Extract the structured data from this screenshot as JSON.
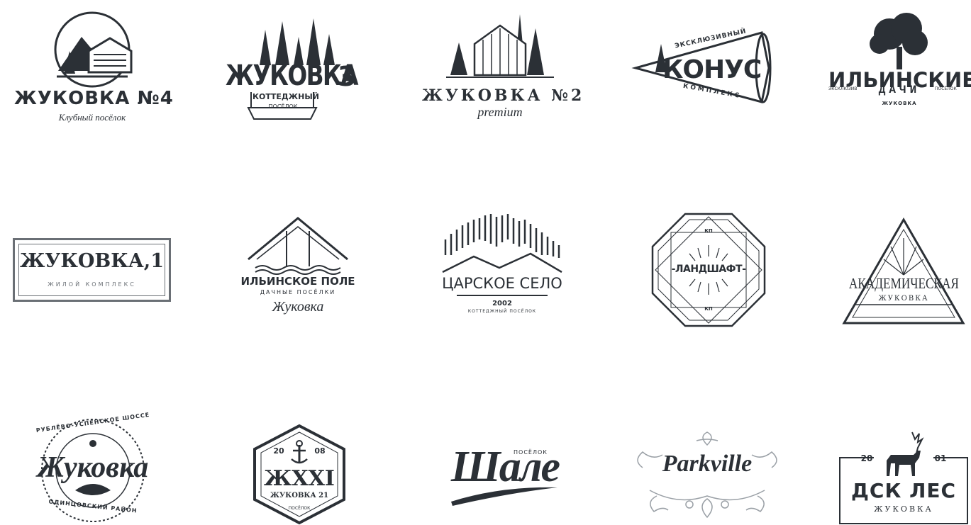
{
  "colors": {
    "ink": "#2b3036",
    "light_ink": "#6a6f75",
    "background": "#ffffff"
  },
  "logos": [
    {
      "name": "zhukovka-4",
      "title": "ЖУКОВКА №4",
      "subtitle": "Клубный посёлок",
      "icon": "mountain-house-icon"
    },
    {
      "name": "zhukovka-3",
      "title": "ЖУКОВКА",
      "number": "3",
      "subtitle": "КОТТЕДЖНЫЙ",
      "small": "ПОСЁЛОК",
      "icon": "pine-forest-icon"
    },
    {
      "name": "zhukovka-2",
      "title": "ЖУКОВКА №2",
      "script": "premium",
      "icon": "house-trees-icon"
    },
    {
      "name": "konus",
      "title": "КОНУС",
      "top": "ЭКСКЛЮЗИВНЫЙ",
      "bottom": "КОМПЛЕКС",
      "icon": "megaphone-icon"
    },
    {
      "name": "ilinskie-dachi",
      "title": "ИЛЬИНСКИЕ",
      "subtitle": "ДАЧИ",
      "small": "ЖУКОВКА",
      "left": "ЭКСКЛЮЗИВ",
      "right": "ПОСЁЛОК",
      "icon": "tree-icon"
    },
    {
      "name": "zhukovka-1",
      "title": "ЖУКОВКА,1",
      "subtitle": "ЖИЛОЙ КОМПЛЕКС"
    },
    {
      "name": "ilinskoe-pole",
      "title": "ИЛЬИНСКОЕ ПОЛЕ",
      "subtitle": "ДАЧНЫЕ ПОСЁЛКИ",
      "script": "Жуковка",
      "icon": "roof-house-icon"
    },
    {
      "name": "tsarskoe-selo",
      "title": "ЦАРСКОЕ СЕЛО",
      "year": "2002",
      "bottom": "КОТТЕДЖНЫЙ ПОСЁЛОК",
      "icon": "aurora-mountain-icon"
    },
    {
      "name": "landshaft",
      "title": "-ЛАНДШАФТ-",
      "top": "КП",
      "bottom": "КП",
      "icon": "octagon-badge-icon"
    },
    {
      "name": "akademicheskaya",
      "title": "АКАДЕМИЧЕСКАЯ",
      "subtitle": "ЖУКОВКА",
      "icon": "triangle-icon"
    },
    {
      "name": "zhukovka-script",
      "title": "Жуковка",
      "top": "РУБЛЁВО-УСПЕНСКОЕ ШОССЕ",
      "bottom": "ОДИНЦОВСКИЙ РАЙОН",
      "icon": "round-stamp-icon"
    },
    {
      "name": "zhxxi",
      "title": "ЖXXI",
      "subtitle": "ЖУКОВКА 21",
      "left_year": "20",
      "right_year": "08",
      "small": "ПОСЁЛОК",
      "icon": "anchor-icon"
    },
    {
      "name": "shale",
      "title": "Шале",
      "small": "ПОСЁЛОК"
    },
    {
      "name": "parkville",
      "title": "Parkville",
      "icon": "floral-ornament-icon"
    },
    {
      "name": "dsk-les",
      "title": "ДСК ЛЕС",
      "subtitle": "ЖУКОВКА",
      "left_year": "20",
      "right_year": "01",
      "icon": "deer-icon"
    }
  ]
}
